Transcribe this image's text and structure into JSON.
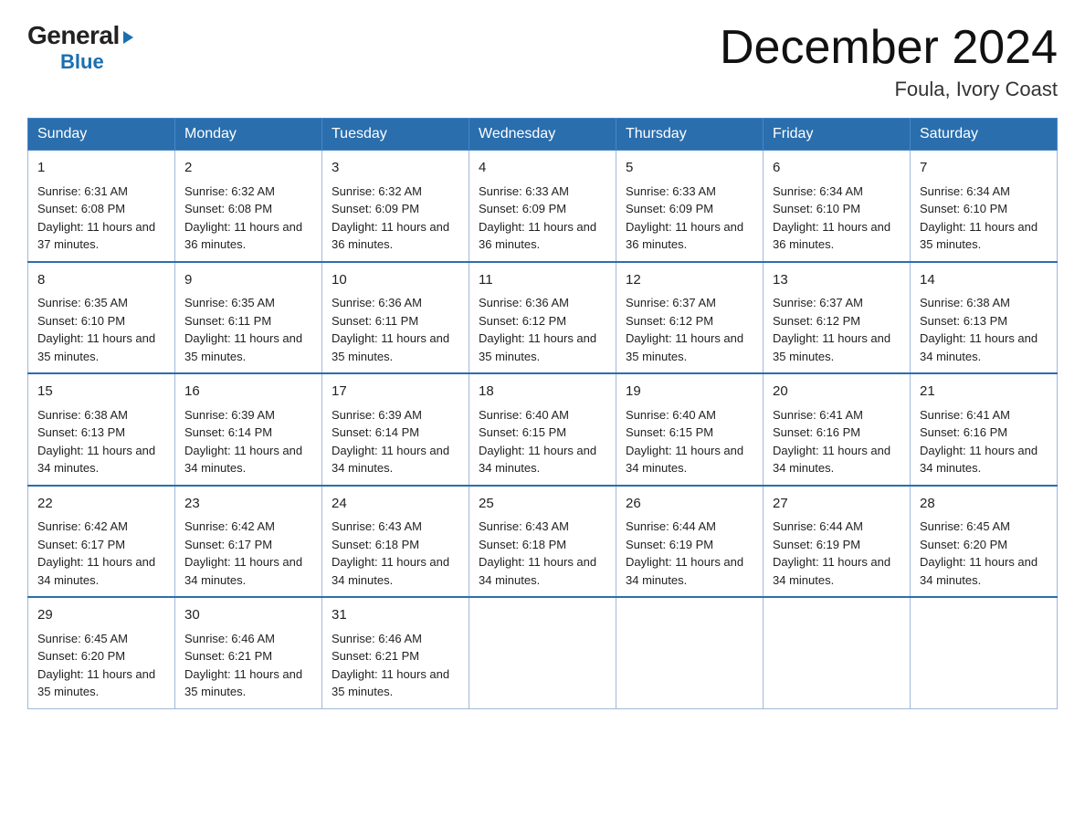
{
  "logo": {
    "general": "General",
    "blue": "Blue",
    "arrow": "▶"
  },
  "title": "December 2024",
  "subtitle": "Foula, Ivory Coast",
  "days": [
    "Sunday",
    "Monday",
    "Tuesday",
    "Wednesday",
    "Thursday",
    "Friday",
    "Saturday"
  ],
  "weeks": [
    [
      {
        "date": "1",
        "sunrise": "6:31 AM",
        "sunset": "6:08 PM",
        "daylight": "11 hours and 37 minutes."
      },
      {
        "date": "2",
        "sunrise": "6:32 AM",
        "sunset": "6:08 PM",
        "daylight": "11 hours and 36 minutes."
      },
      {
        "date": "3",
        "sunrise": "6:32 AM",
        "sunset": "6:09 PM",
        "daylight": "11 hours and 36 minutes."
      },
      {
        "date": "4",
        "sunrise": "6:33 AM",
        "sunset": "6:09 PM",
        "daylight": "11 hours and 36 minutes."
      },
      {
        "date": "5",
        "sunrise": "6:33 AM",
        "sunset": "6:09 PM",
        "daylight": "11 hours and 36 minutes."
      },
      {
        "date": "6",
        "sunrise": "6:34 AM",
        "sunset": "6:10 PM",
        "daylight": "11 hours and 36 minutes."
      },
      {
        "date": "7",
        "sunrise": "6:34 AM",
        "sunset": "6:10 PM",
        "daylight": "11 hours and 35 minutes."
      }
    ],
    [
      {
        "date": "8",
        "sunrise": "6:35 AM",
        "sunset": "6:10 PM",
        "daylight": "11 hours and 35 minutes."
      },
      {
        "date": "9",
        "sunrise": "6:35 AM",
        "sunset": "6:11 PM",
        "daylight": "11 hours and 35 minutes."
      },
      {
        "date": "10",
        "sunrise": "6:36 AM",
        "sunset": "6:11 PM",
        "daylight": "11 hours and 35 minutes."
      },
      {
        "date": "11",
        "sunrise": "6:36 AM",
        "sunset": "6:12 PM",
        "daylight": "11 hours and 35 minutes."
      },
      {
        "date": "12",
        "sunrise": "6:37 AM",
        "sunset": "6:12 PM",
        "daylight": "11 hours and 35 minutes."
      },
      {
        "date": "13",
        "sunrise": "6:37 AM",
        "sunset": "6:12 PM",
        "daylight": "11 hours and 35 minutes."
      },
      {
        "date": "14",
        "sunrise": "6:38 AM",
        "sunset": "6:13 PM",
        "daylight": "11 hours and 34 minutes."
      }
    ],
    [
      {
        "date": "15",
        "sunrise": "6:38 AM",
        "sunset": "6:13 PM",
        "daylight": "11 hours and 34 minutes."
      },
      {
        "date": "16",
        "sunrise": "6:39 AM",
        "sunset": "6:14 PM",
        "daylight": "11 hours and 34 minutes."
      },
      {
        "date": "17",
        "sunrise": "6:39 AM",
        "sunset": "6:14 PM",
        "daylight": "11 hours and 34 minutes."
      },
      {
        "date": "18",
        "sunrise": "6:40 AM",
        "sunset": "6:15 PM",
        "daylight": "11 hours and 34 minutes."
      },
      {
        "date": "19",
        "sunrise": "6:40 AM",
        "sunset": "6:15 PM",
        "daylight": "11 hours and 34 minutes."
      },
      {
        "date": "20",
        "sunrise": "6:41 AM",
        "sunset": "6:16 PM",
        "daylight": "11 hours and 34 minutes."
      },
      {
        "date": "21",
        "sunrise": "6:41 AM",
        "sunset": "6:16 PM",
        "daylight": "11 hours and 34 minutes."
      }
    ],
    [
      {
        "date": "22",
        "sunrise": "6:42 AM",
        "sunset": "6:17 PM",
        "daylight": "11 hours and 34 minutes."
      },
      {
        "date": "23",
        "sunrise": "6:42 AM",
        "sunset": "6:17 PM",
        "daylight": "11 hours and 34 minutes."
      },
      {
        "date": "24",
        "sunrise": "6:43 AM",
        "sunset": "6:18 PM",
        "daylight": "11 hours and 34 minutes."
      },
      {
        "date": "25",
        "sunrise": "6:43 AM",
        "sunset": "6:18 PM",
        "daylight": "11 hours and 34 minutes."
      },
      {
        "date": "26",
        "sunrise": "6:44 AM",
        "sunset": "6:19 PM",
        "daylight": "11 hours and 34 minutes."
      },
      {
        "date": "27",
        "sunrise": "6:44 AM",
        "sunset": "6:19 PM",
        "daylight": "11 hours and 34 minutes."
      },
      {
        "date": "28",
        "sunrise": "6:45 AM",
        "sunset": "6:20 PM",
        "daylight": "11 hours and 34 minutes."
      }
    ],
    [
      {
        "date": "29",
        "sunrise": "6:45 AM",
        "sunset": "6:20 PM",
        "daylight": "11 hours and 35 minutes."
      },
      {
        "date": "30",
        "sunrise": "6:46 AM",
        "sunset": "6:21 PM",
        "daylight": "11 hours and 35 minutes."
      },
      {
        "date": "31",
        "sunrise": "6:46 AM",
        "sunset": "6:21 PM",
        "daylight": "11 hours and 35 minutes."
      },
      null,
      null,
      null,
      null
    ]
  ],
  "labels": {
    "sunrise": "Sunrise:",
    "sunset": "Sunset:",
    "daylight": "Daylight:"
  }
}
